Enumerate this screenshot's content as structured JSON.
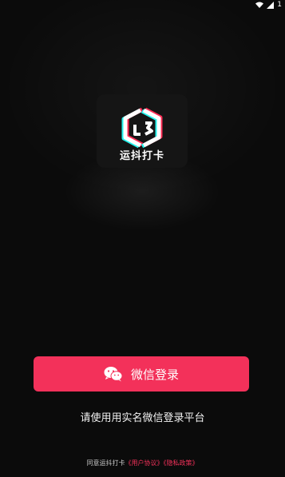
{
  "status_bar": {
    "battery_text": "1"
  },
  "logo": {
    "text": "运抖打卡"
  },
  "login": {
    "button_label": "微信登录",
    "icon": "wechat-icon"
  },
  "hint": "请使用用实名微信登录平台",
  "agreement": {
    "prefix": "同意运抖打卡",
    "user_agreement": "《用户协议》",
    "privacy_policy": "《隐私政策》"
  },
  "colors": {
    "accent": "#f3315a",
    "background": "#0b0b0b"
  }
}
